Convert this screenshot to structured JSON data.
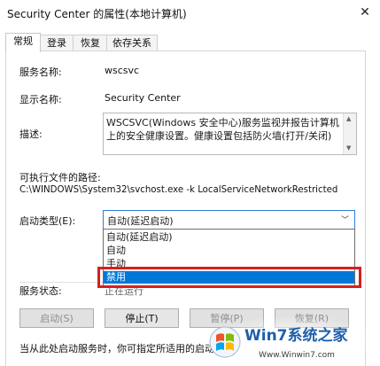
{
  "window": {
    "title": "Security Center 的属性(本地计算机)"
  },
  "tabs": [
    {
      "label": "常规",
      "active": true
    },
    {
      "label": "登录",
      "active": false
    },
    {
      "label": "恢复",
      "active": false
    },
    {
      "label": "依存关系",
      "active": false
    }
  ],
  "general": {
    "service_name_label": "服务名称:",
    "service_name": "wscsvc",
    "display_name_label": "显示名称:",
    "display_name": "Security Center",
    "description_label": "描述:",
    "description": "WSCSVC(Windows 安全中心)服务监视并报告计算机上的安全健康设置。健康设置包括防火墙(打开/关闭)",
    "exe_path_label": "可执行文件的路径:",
    "exe_path": "C:\\WINDOWS\\System32\\svchost.exe -k LocalServiceNetworkRestricted",
    "startup_type_label": "启动类型(E):",
    "startup_type_value": "自动(延迟启动)",
    "startup_options": [
      "自动(延迟启动)",
      "自动",
      "手动",
      "禁用"
    ],
    "startup_selected": "禁用",
    "service_status_label": "服务状态:",
    "service_status": "正在运行"
  },
  "buttons": {
    "start": "启动(S)",
    "stop": "停止(T)",
    "pause": "暂停(P)",
    "resume": "恢复(R)"
  },
  "footer_text": "当从此处启动服务时，你可指定所适用的启动参",
  "watermark": {
    "brand": "Win7系统之家",
    "url": "Www.Winwin7.com"
  },
  "colors": {
    "selection": "#0078d7",
    "highlight_border": "#d41f1f",
    "combo_focus": "#2f7ed8"
  }
}
